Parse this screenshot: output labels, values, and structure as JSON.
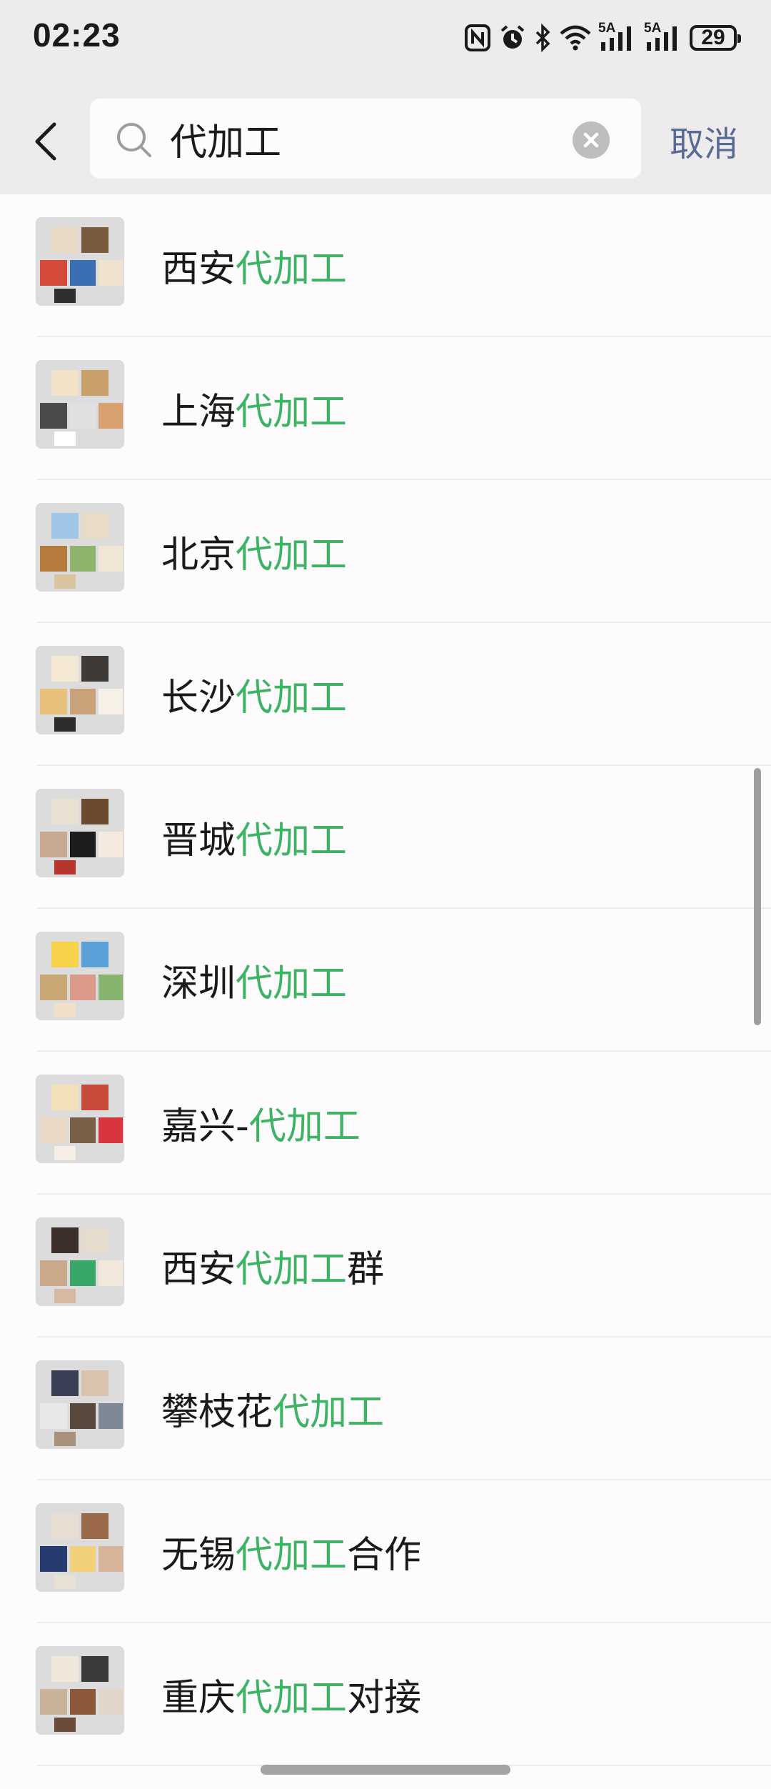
{
  "status_bar": {
    "time": "02:23",
    "network_label_1": "5A",
    "network_label_2": "5A",
    "battery_level": "29"
  },
  "search": {
    "query": "代加工",
    "cancel_label": "取消"
  },
  "colors": {
    "highlight": "#3cb464",
    "cancel": "#576b95"
  },
  "results": [
    {
      "pre": "西安",
      "hl": "代加工",
      "post": ""
    },
    {
      "pre": "上海",
      "hl": "代加工",
      "post": ""
    },
    {
      "pre": "北京",
      "hl": "代加工",
      "post": ""
    },
    {
      "pre": "长沙",
      "hl": "代加工",
      "post": ""
    },
    {
      "pre": "晋城",
      "hl": "代加工",
      "post": ""
    },
    {
      "pre": "深圳",
      "hl": "代加工",
      "post": ""
    },
    {
      "pre": "嘉兴-",
      "hl": "代加工",
      "post": ""
    },
    {
      "pre": "西安",
      "hl": "代加工",
      "post": "群"
    },
    {
      "pre": "攀枝花",
      "hl": "代加工",
      "post": ""
    },
    {
      "pre": "无锡",
      "hl": "代加工",
      "post": "合作"
    },
    {
      "pre": "重庆",
      "hl": "代加工",
      "post": "对接"
    }
  ]
}
